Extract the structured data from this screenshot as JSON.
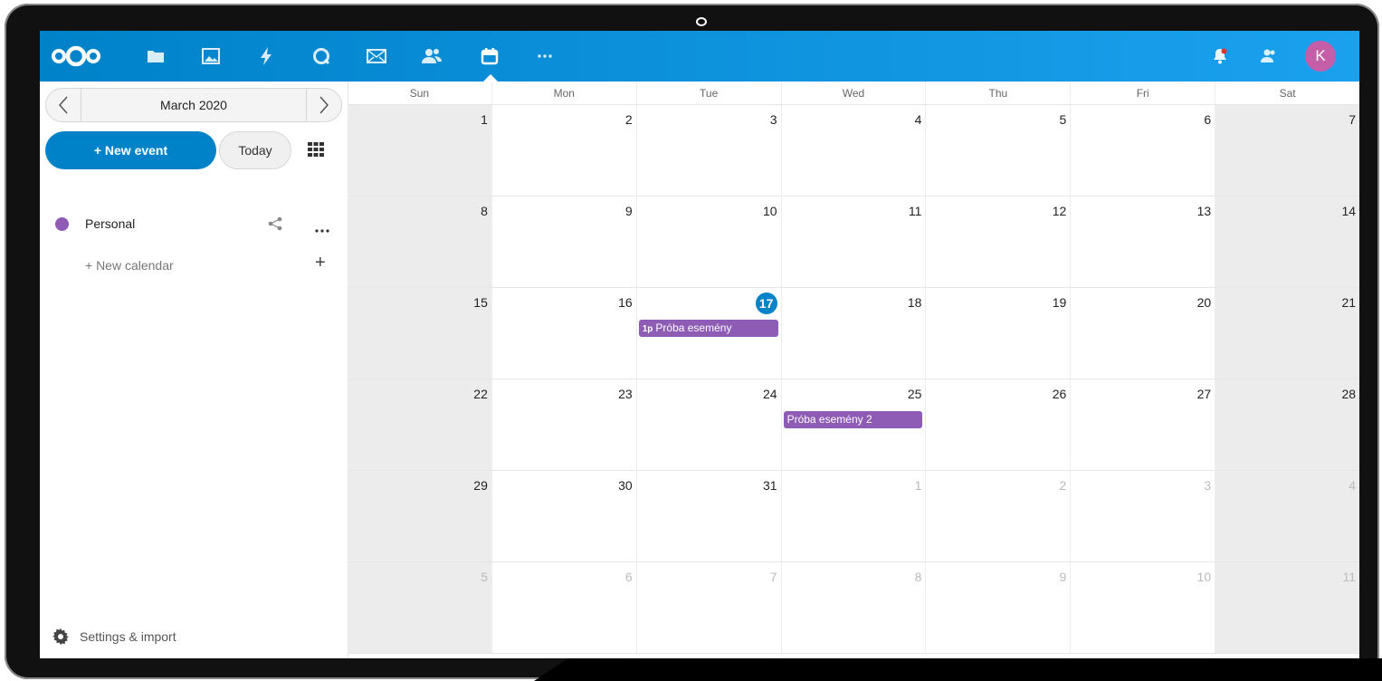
{
  "header": {
    "apps": [
      {
        "name": "files-app-icon"
      },
      {
        "name": "photos-app-icon"
      },
      {
        "name": "activity-app-icon"
      },
      {
        "name": "talk-app-icon"
      },
      {
        "name": "mail-app-icon"
      },
      {
        "name": "contacts-app-icon"
      },
      {
        "name": "calendar-app-icon"
      },
      {
        "name": "more-apps-icon"
      }
    ],
    "avatar_initial": "K"
  },
  "sidebar": {
    "month_label": "March 2020",
    "new_event_label": "+ New event",
    "today_label": "Today",
    "calendars": [
      {
        "name": "Personal",
        "color": "#8e5bb5"
      }
    ],
    "new_calendar_label": "+ New calendar",
    "settings_label": "Settings & import"
  },
  "calendar": {
    "weekdays": [
      "Sun",
      "Mon",
      "Tue",
      "Wed",
      "Thu",
      "Fri",
      "Sat"
    ],
    "weeks": [
      [
        {
          "n": "1"
        },
        {
          "n": "2"
        },
        {
          "n": "3"
        },
        {
          "n": "4"
        },
        {
          "n": "5"
        },
        {
          "n": "6"
        },
        {
          "n": "7"
        }
      ],
      [
        {
          "n": "8"
        },
        {
          "n": "9"
        },
        {
          "n": "10"
        },
        {
          "n": "11"
        },
        {
          "n": "12"
        },
        {
          "n": "13"
        },
        {
          "n": "14"
        }
      ],
      [
        {
          "n": "15"
        },
        {
          "n": "16"
        },
        {
          "n": "17",
          "today": true,
          "event_time": "1p",
          "event_title": "Próba esemény"
        },
        {
          "n": "18"
        },
        {
          "n": "19"
        },
        {
          "n": "20"
        },
        {
          "n": "21"
        }
      ],
      [
        {
          "n": "22"
        },
        {
          "n": "23"
        },
        {
          "n": "24"
        },
        {
          "n": "25",
          "event_title": "Próba esemény 2"
        },
        {
          "n": "26"
        },
        {
          "n": "27"
        },
        {
          "n": "28"
        }
      ],
      [
        {
          "n": "29"
        },
        {
          "n": "30"
        },
        {
          "n": "31"
        },
        {
          "n": "1",
          "other": true
        },
        {
          "n": "2",
          "other": true
        },
        {
          "n": "3",
          "other": true
        },
        {
          "n": "4",
          "other": true
        }
      ],
      [
        {
          "n": "5",
          "other": true
        },
        {
          "n": "6",
          "other": true
        },
        {
          "n": "7",
          "other": true
        },
        {
          "n": "8",
          "other": true
        },
        {
          "n": "9",
          "other": true
        },
        {
          "n": "10",
          "other": true
        },
        {
          "n": "11",
          "other": true
        }
      ]
    ],
    "accent_color": "#0082c9",
    "event_color": "#8e5bb5"
  }
}
